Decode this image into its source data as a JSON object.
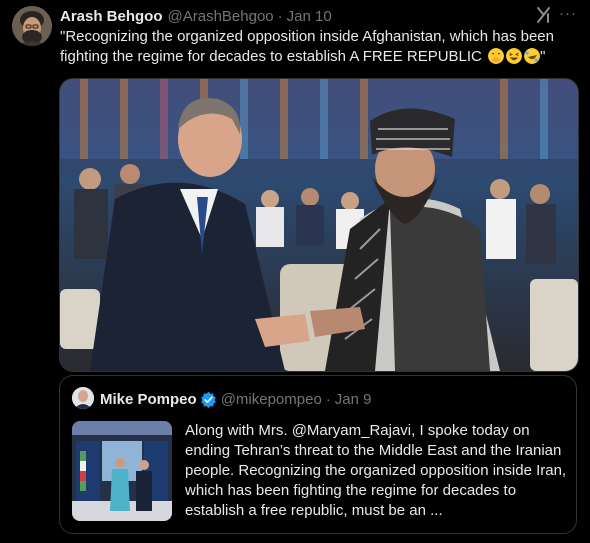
{
  "tweet": {
    "author_name": "Arash Behgoo",
    "author_handle": "@ArashBehgoo",
    "separator": "·",
    "date": "Jan 10",
    "text": "\"Recognizing the organized opposition inside Afghanistan, which has been fighting the regime for decades to establish A FREE REPUBLIC",
    "emojis": [
      "face-with-hand-over-mouth",
      "grinning-squinting-face",
      "rolling-on-the-floor-laughing"
    ],
    "text_end": "\"",
    "grok_icon": "grok-icon",
    "more_icon": "more-icon",
    "more_label": "···"
  },
  "quoted_tweet": {
    "author_name": "Mike Pompeo",
    "verified_icon": "verified-badge-icon",
    "author_handle": "@mikepompeo",
    "separator": "·",
    "date": "Jan 9",
    "text": "Along with Mrs. @Maryam_Rajavi, I spoke today on ending Tehran’s threat to the Middle East and the Iranian people. Recognizing the organized opposition inside Iran, which has been fighting the regime for decades to establish a free republic, must be an ..."
  },
  "colors": {
    "background": "#000000",
    "text": "#e7e9ea",
    "secondary_text": "#71767b",
    "border": "#2f3336",
    "verified_blue": "#1d9bf0"
  }
}
